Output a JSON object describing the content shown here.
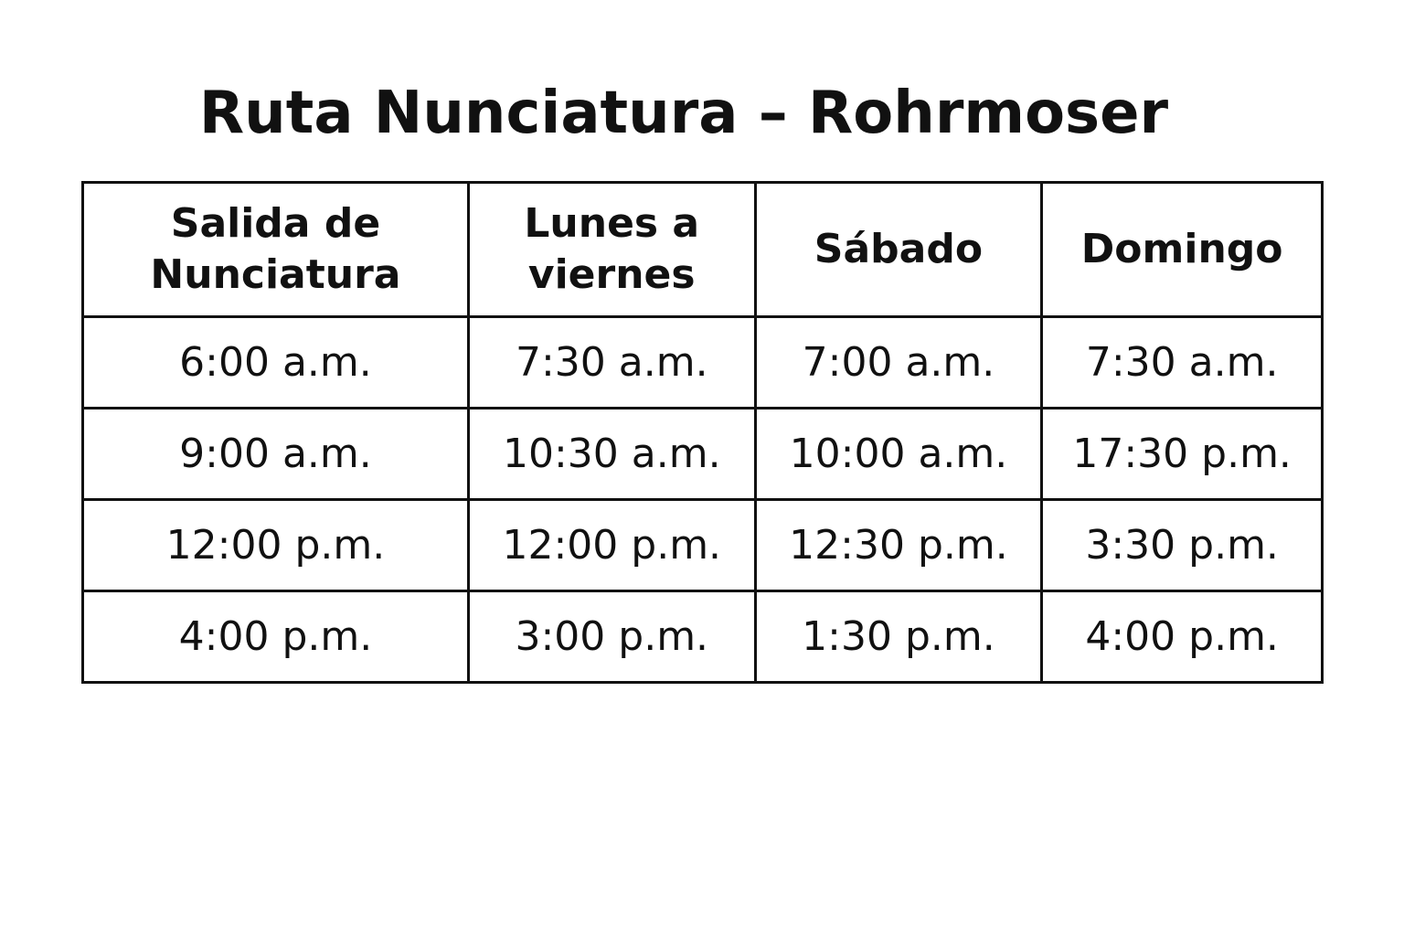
{
  "title": "Ruta Nunciatura – Rohrmoser",
  "table": {
    "headers": [
      "Salida de Nunciatura",
      "Lunes a viernes",
      "Sábado",
      "Domingo"
    ],
    "rows": [
      [
        "6:00 a.m.",
        "7:30 a.m.",
        "7:00 a.m.",
        "7:30 a.m."
      ],
      [
        "9:00 a.m.",
        "10:30 a.m.",
        "10:00 a.m.",
        "17:30 p.m."
      ],
      [
        "12:00 p.m.",
        "12:00 p.m.",
        "12:30 p.m.",
        "3:30 p.m."
      ],
      [
        "4:00 p.m.",
        "3:00 p.m.",
        "1:30 p.m.",
        "4:00 p.m."
      ]
    ]
  }
}
